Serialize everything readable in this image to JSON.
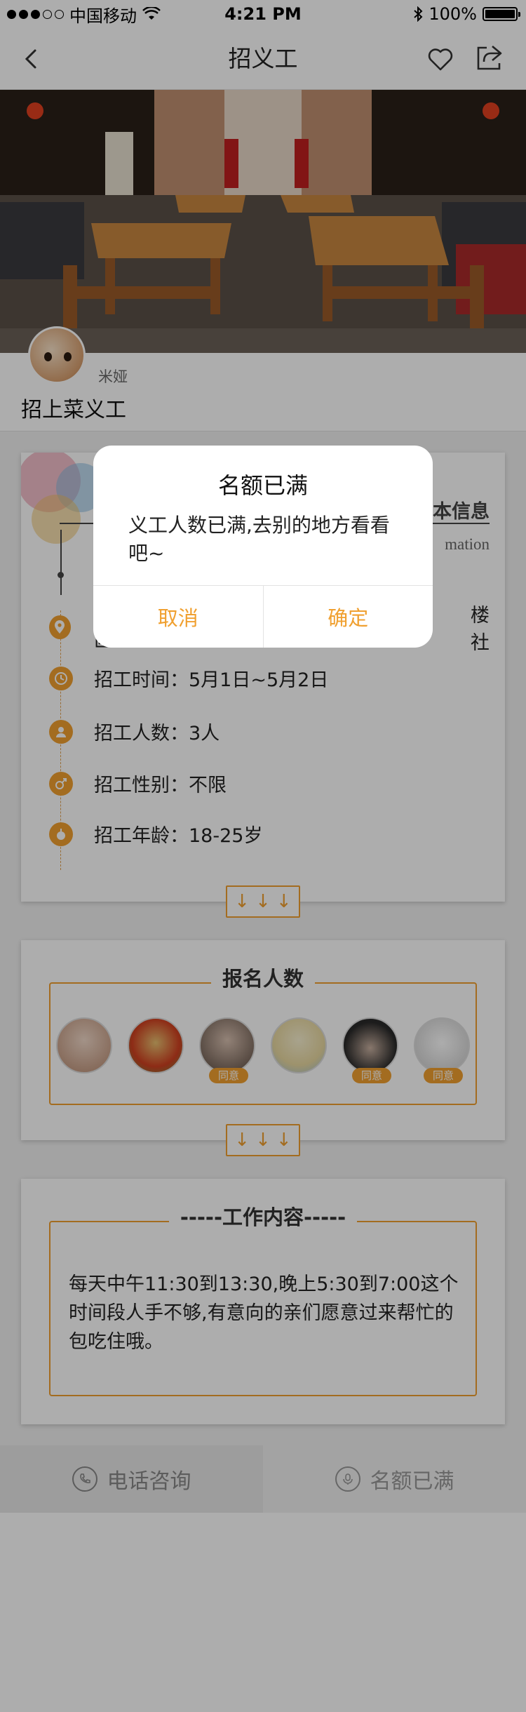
{
  "status_bar": {
    "carrier": "中国移动",
    "time": "4:21 PM",
    "battery": "100%"
  },
  "nav": {
    "title": "招义工"
  },
  "event": {
    "username": "米娅",
    "title": "招上菜义工"
  },
  "basic_info": {
    "section_title": "本信息",
    "section_subtitle": "mation",
    "address_partial": "楼社",
    "address_line2": "区铁路",
    "time": "招工时间：5月1日~5月2日",
    "count": "招工人数：3人",
    "gender": "招工性别：不限",
    "age": "招工年龄：18-25岁"
  },
  "applicants": {
    "section_title": "报名人数",
    "agree_label": "同意"
  },
  "work": {
    "section_title": "工作内容",
    "description": "每天中午11:30到13:30,晚上5:30到7:00这个时间段人手不够,有意向的亲们愿意过来帮忙的包吃住哦。"
  },
  "bottom_bar": {
    "call_label": "电话咨询",
    "full_label": "名额已满"
  },
  "dialog": {
    "title": "名额已满",
    "message": "义工人数已满,去别的地方看看吧~",
    "cancel": "取消",
    "confirm": "确定"
  },
  "colors": {
    "accent": "#f0a030"
  }
}
